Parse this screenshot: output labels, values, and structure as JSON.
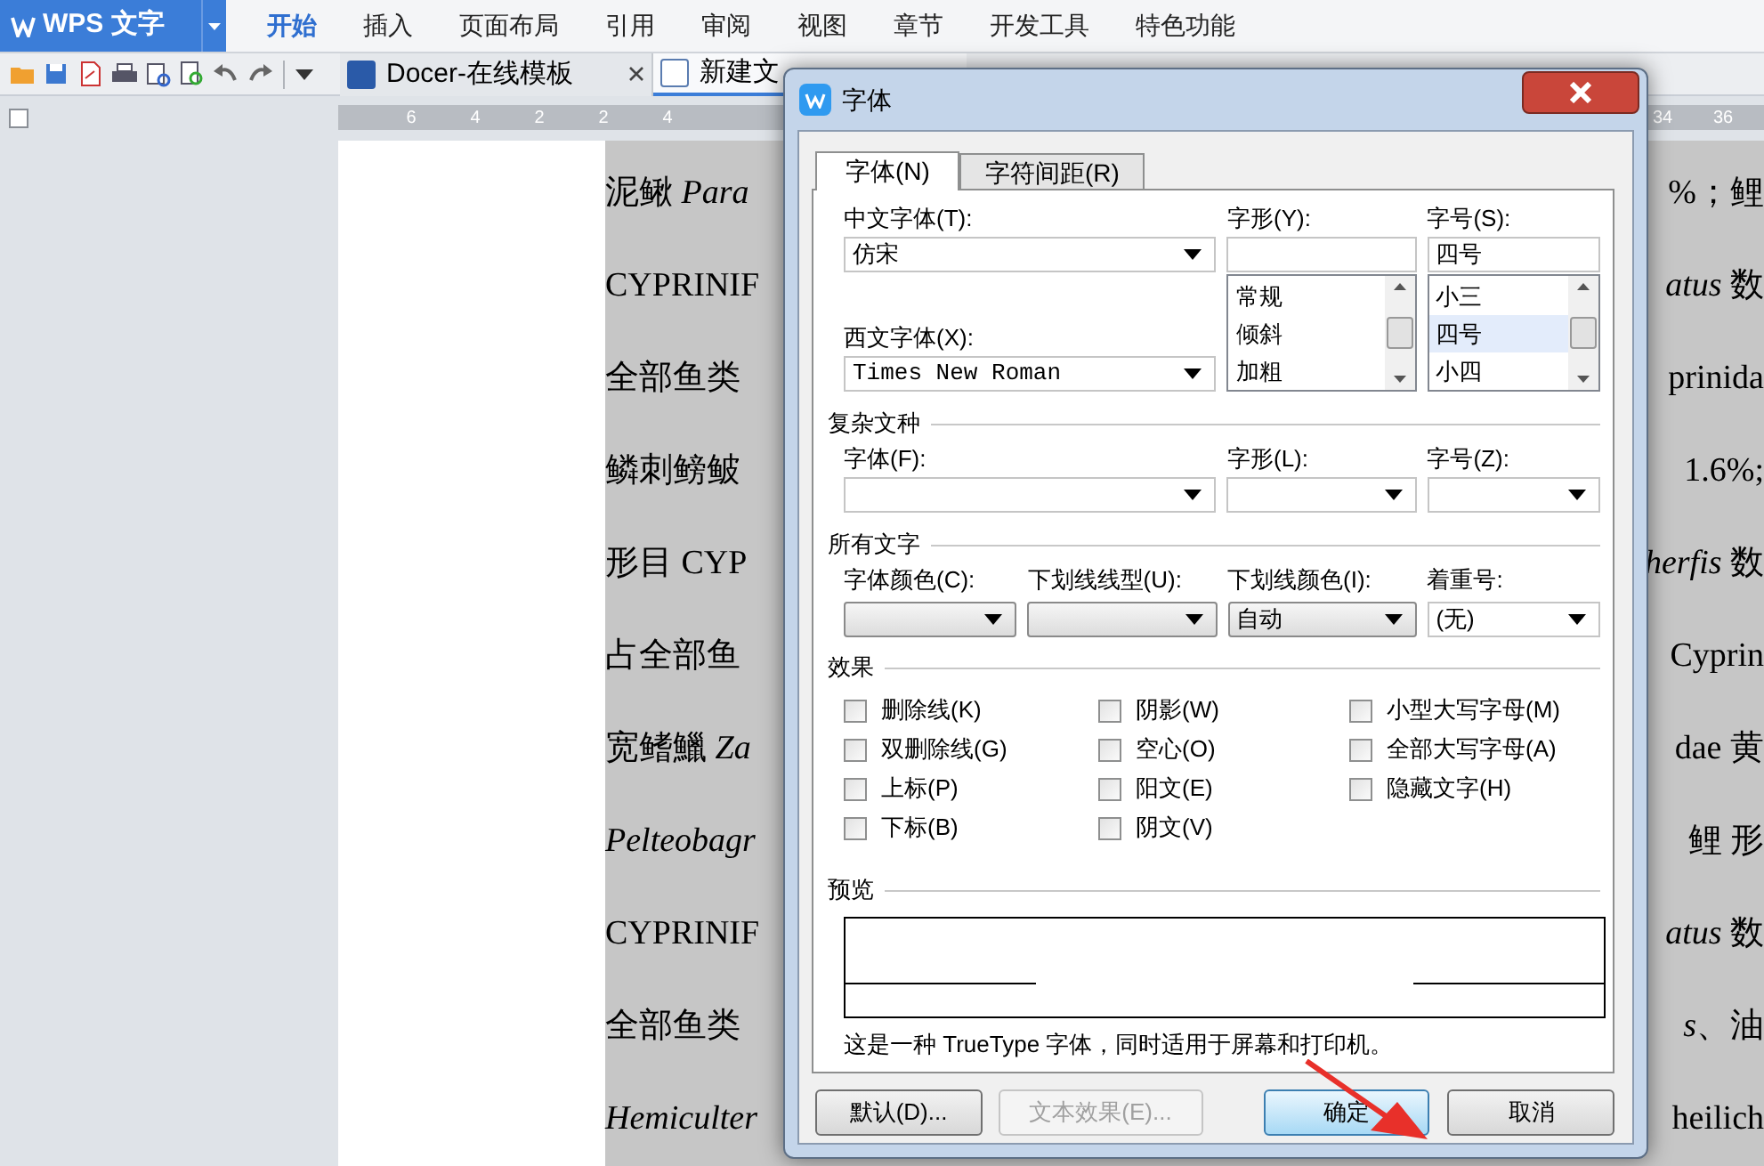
{
  "app_button": {
    "label": "WPS 文字"
  },
  "menu_tabs": [
    {
      "label": "开始",
      "selected": true
    },
    {
      "label": "插入",
      "selected": false
    },
    {
      "label": "页面布局",
      "selected": false
    },
    {
      "label": "引用",
      "selected": false
    },
    {
      "label": "审阅",
      "selected": false
    },
    {
      "label": "视图",
      "selected": false
    },
    {
      "label": "章节",
      "selected": false
    },
    {
      "label": "开发工具",
      "selected": false
    },
    {
      "label": "特色功能",
      "selected": false
    }
  ],
  "doc_tabs": [
    {
      "label": "Docer-在线模板",
      "selected": false
    },
    {
      "label": "新建文",
      "selected": true
    }
  ],
  "ruler": {
    "left_labels": [
      "6",
      "4",
      "2",
      "2",
      "4"
    ],
    "right_labels": [
      "34",
      "36"
    ]
  },
  "document_lines": [
    {
      "left": "泥鳅 *Para*",
      "right": "%；鲤"
    },
    {
      "left": "CYPRINIF",
      "right": "*atus* 数"
    },
    {
      "left": "全部鱼类",
      "right": "prinida"
    },
    {
      "left": "鳞刺鳑鲏",
      "right": "1.6%;"
    },
    {
      "left": "形目 CYP",
      "right": "*herfis* 数"
    },
    {
      "left": "占全部鱼",
      "right": "Cyprin"
    },
    {
      "left": "宽鳍鱲 *Za*",
      "right": "dae 黄"
    },
    {
      "left": "Pelteobagr",
      "left_italic": true,
      "right": "鲤 形"
    },
    {
      "left": "CYPRINIF",
      "right": "*atus* 数"
    },
    {
      "left": "全部鱼类",
      "right": "*s*、油"
    },
    {
      "left": "Hemiculter",
      "left_italic": true,
      "right": "heilich"
    }
  ],
  "dialog": {
    "title": "字体",
    "tabs": [
      {
        "label": "字体(N)",
        "selected": true
      },
      {
        "label": "字符间距(R)",
        "selected": false
      }
    ],
    "chinese_font": {
      "label": "中文字体(T):",
      "value": "仿宋"
    },
    "western_font": {
      "label": "西文字体(X):",
      "value": "Times New Roman"
    },
    "style": {
      "label": "字形(Y):",
      "items": [
        {
          "label": "常规",
          "selected": false
        },
        {
          "label": "倾斜",
          "selected": false
        },
        {
          "label": "加粗",
          "selected": false
        }
      ]
    },
    "size": {
      "label": "字号(S):",
      "value": "四号",
      "items": [
        {
          "label": "小三",
          "selected": false
        },
        {
          "label": "四号",
          "selected": true
        },
        {
          "label": "小四",
          "selected": false
        }
      ]
    },
    "complex_section": "复杂文种",
    "complex_fields": [
      {
        "label": "字体(F):"
      },
      {
        "label": "字形(L):"
      },
      {
        "label": "字号(Z):"
      }
    ],
    "all_text_section": "所有文字",
    "all_text_fields": [
      {
        "label": "字体颜色(C):"
      },
      {
        "label": "下划线线型(U):"
      },
      {
        "label": "下划线颜色(I):",
        "value": "自动"
      },
      {
        "label": "着重号:",
        "value": "(无)",
        "kind": "combo"
      }
    ],
    "effects_section": "效果",
    "effects": [
      {
        "label": "删除线(K)",
        "checked": false
      },
      {
        "label": "阴影(W)",
        "checked": false
      },
      {
        "label": "小型大写字母(M)",
        "checked": false
      },
      {
        "label": "双删除线(G)",
        "checked": false
      },
      {
        "label": "空心(O)",
        "checked": false
      },
      {
        "label": "全部大写字母(A)",
        "checked": false
      },
      {
        "label": "上标(P)",
        "checked": false
      },
      {
        "label": "阳文(E)",
        "checked": false
      },
      {
        "label": "隐藏文字(H)",
        "checked": false
      },
      {
        "label": "下标(B)",
        "checked": false
      },
      {
        "label": "阴文(V)",
        "checked": false
      }
    ],
    "preview_section": "预览",
    "caption": "这是一种 TrueType 字体，同时适用于屏幕和打印机。",
    "buttons": [
      {
        "label": "默认(D)...",
        "disabled": false,
        "focused": false
      },
      {
        "label": "文本效果(E)...",
        "disabled": true,
        "focused": false
      },
      {
        "label": "确定",
        "disabled": false,
        "focused": true
      },
      {
        "label": "取消",
        "disabled": false,
        "focused": false
      }
    ]
  }
}
